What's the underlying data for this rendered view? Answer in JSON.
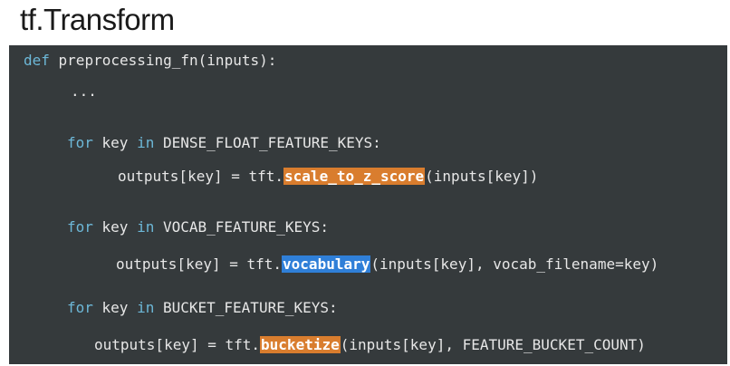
{
  "title": "tf.Transform",
  "code": {
    "def_kw": "def",
    "def_rest": " preprocessing_fn(inputs):",
    "ellipsis": "...",
    "for1_kw_for": "for",
    "for1_key": " key ",
    "for1_kw_in": "in",
    "for1_rest": " DENSE_FLOAT_FEATURE_KEYS:",
    "out1_pre": "outputs[key] = tft.",
    "out1_fn": "scale_to_z_score",
    "out1_post": "(inputs[key])",
    "for2_kw_for": "for",
    "for2_key": " key ",
    "for2_kw_in": "in",
    "for2_rest": " VOCAB_FEATURE_KEYS:",
    "out2_pre": "outputs[key] = tft.",
    "out2_fn": "vocabulary",
    "out2_post": "(inputs[key], vocab_filename=key)",
    "for3_kw_for": "for",
    "for3_key": " key ",
    "for3_kw_in": "in",
    "for3_rest": " BUCKET_FEATURE_KEYS:",
    "out3_pre": "outputs[key] = tft.",
    "out3_fn": "bucketize",
    "out3_post": "(inputs[key], FEATURE_BUCKET_COUNT)"
  },
  "colors": {
    "keyword": "#6db8d8",
    "highlight_orange": "#d97d2e",
    "highlight_blue": "#2f7fd8",
    "code_background": "#353a3c"
  }
}
